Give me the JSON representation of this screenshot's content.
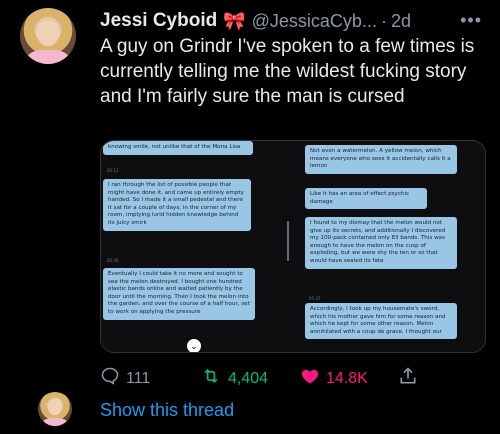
{
  "tweet": {
    "display_name": "Jessi Cyboid",
    "name_emoji": "🎀",
    "handle": "@JessicaCyb...",
    "dot": "·",
    "timestamp": "2d",
    "more": "•••",
    "text": "A guy on Grindr I've spoken to a few times is currently telling me the wildest fucking story and I'm fairly sure the man is cursed"
  },
  "media": {
    "left_column": [
      {
        "text": "knowing smile, not unlike that of the Mona Lisa",
        "time": "05:12"
      },
      {
        "text": "I ran through the list of possible people that might have done it, and came up entirely empty handed. So I made it a small pedestal and there it sat for a couple of days, in the corner of my room, implying lurid hidden knowledge behind its juicy smirk",
        "time": "05:46"
      },
      {
        "text": "Eventually I could take it no more and sought to see the melon destroyed. I bought one hundred elastic bands online and waited patiently by the door until the morning. Then I took the melon into the garden, and over the course of a half hour, set to work on applying the pressure",
        "time": ""
      }
    ],
    "right_column": [
      {
        "text": "Not even a watermelon. A yellow melon, which means everyone who sees it accidentally calls it a lemon",
        "time": ""
      },
      {
        "text": "Like it has an area of effect psychic damage",
        "time": ""
      },
      {
        "text": "I found to my dismay that the melon would not give up its secrets, and additionally I discovered my 100-pack contained only 83 bands. This was enough to have the melon on the cusp of exploding, but we were shy the ten or so that would have sealed its fate",
        "time": "05:47"
      },
      {
        "text": "Accordingly, I took up my housemate's sword, which his mother gave him for some reason and which he kept for some other reason. Melon annihilated with a coup de grace. I thought our",
        "time": ""
      }
    ],
    "scroll_icon": "⌄"
  },
  "actions": {
    "reply_count": "111",
    "retweet_count": "4,404",
    "like_count": "14.8K",
    "reply_icon": "speech-bubble-icon",
    "retweet_icon": "retweet-icon",
    "like_icon": "heart-icon",
    "share_icon": "share-icon"
  },
  "show_thread": "Show this thread"
}
